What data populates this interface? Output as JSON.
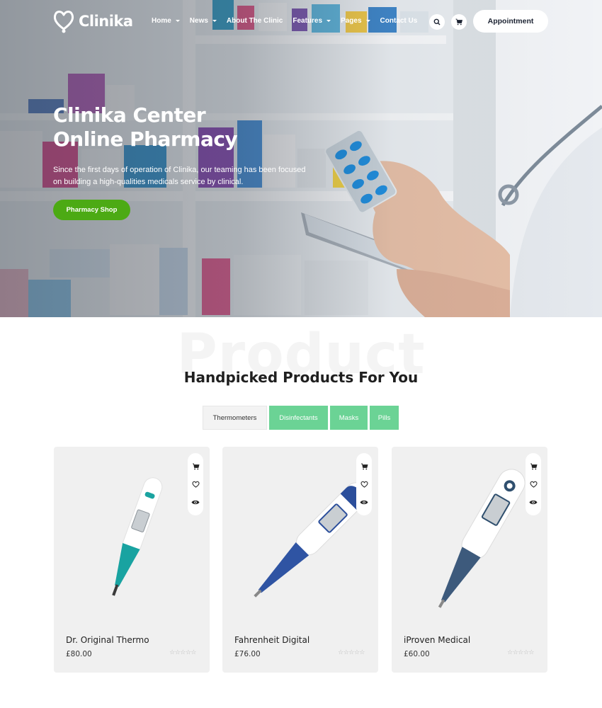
{
  "brand": {
    "name": "Clinika"
  },
  "nav": {
    "items": [
      {
        "label": "Home",
        "dropdown": true
      },
      {
        "label": "News",
        "dropdown": true
      },
      {
        "label": "About The Clinic",
        "dropdown": false
      },
      {
        "label": "Features",
        "dropdown": true
      },
      {
        "label": "Pages",
        "dropdown": true
      },
      {
        "label": "Contact Us",
        "dropdown": false
      }
    ],
    "icons": [
      "search-icon",
      "cart-icon"
    ],
    "appointment_label": "Appointment"
  },
  "hero": {
    "title_line1": "Clinika Center",
    "title_line2": "Online Pharmacy",
    "description": "Since the first days of operation of Clinika, our teaming has been focused on building a high-qualities medicals service by clinical.",
    "cta_label": "Pharmacy Shop"
  },
  "products": {
    "watermark": "Product",
    "title": "Handpicked Products For You",
    "tabs": [
      {
        "label": "Thermometers",
        "active": true
      },
      {
        "label": "Disinfectants",
        "active": false
      },
      {
        "label": "Masks",
        "active": false
      },
      {
        "label": "Pills",
        "active": false
      }
    ],
    "items": [
      {
        "name": "Dr. Original Thermo",
        "price": "£80.00",
        "rating": 0
      },
      {
        "name": "Fahrenheit Digital",
        "price": "£76.00",
        "rating": 0
      },
      {
        "name": "iProven Medical",
        "price": "£60.00",
        "rating": 0
      }
    ]
  },
  "colors": {
    "accent_green": "#4caa14",
    "tab_green": "#6bd395",
    "dark_text": "#1f1f1f"
  }
}
